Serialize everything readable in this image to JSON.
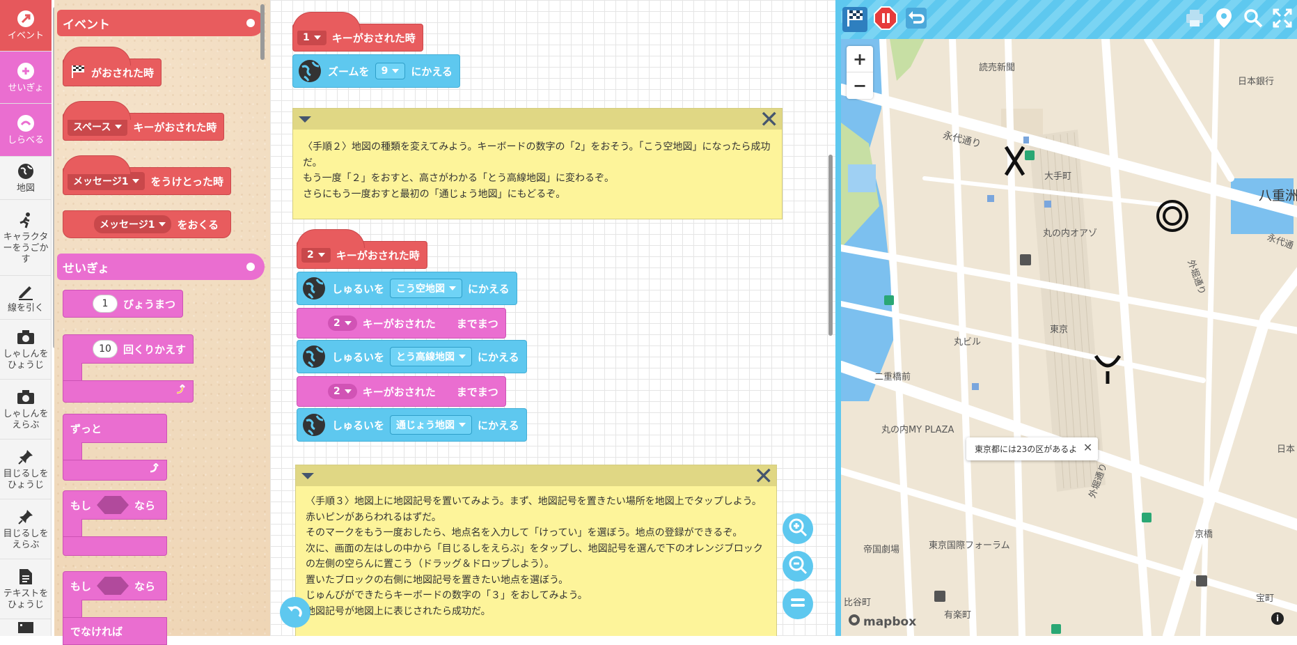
{
  "sidebar": {
    "items": [
      {
        "label": "イベント"
      },
      {
        "label": "せいぎょ"
      },
      {
        "label": "しらべる"
      },
      {
        "label": "地図"
      },
      {
        "label": "キャラクターをうごかす"
      },
      {
        "label": "線を引く"
      },
      {
        "label": "しゃしんをひょうじ"
      },
      {
        "label": "しゃしんをえらぶ"
      },
      {
        "label": "目じるしをひょうじ"
      },
      {
        "label": "目じるしをえらぶ"
      },
      {
        "label": "テキストをひょうじ"
      }
    ]
  },
  "palette": {
    "event_header": "イベント",
    "control_header": "せいぎょ",
    "flag_block": "がおされた時",
    "key_block_dropdown": "スペース",
    "key_block_text": "キーがおされた時",
    "msg_recv_dropdown": "メッセージ1",
    "msg_recv_text": "をうけとった時",
    "msg_send_dropdown": "メッセージ1",
    "msg_send_text": "をおくる",
    "wait_value": "1",
    "wait_text": "びょうまつ",
    "repeat_value": "10",
    "repeat_text": "回くりかえす",
    "forever_text": "ずっと",
    "if_text_1": "もし",
    "if_text_2": "なら",
    "ifelse_text_1": "もし",
    "ifelse_text_2": "なら",
    "else_text": "でなければ"
  },
  "workspace": {
    "script1": {
      "key": "1",
      "hat_text": "キーがおされた時",
      "zoom_text1": "ズームを",
      "zoom_value": "9",
      "zoom_text2": "にかえる"
    },
    "note1": {
      "lines": [
        "〈手順２〉地図の種類を変えてみよう。キーボードの数字の「2」をおそう。「こう空地図」になったら成功だ。",
        "もう一度「２」をおすと、高さがわかる「とう高線地図」に変わるぞ。",
        "さらにもう一度おすと最初の「通じょう地図」にもどるぞ。"
      ]
    },
    "script2": {
      "key": "2",
      "hat_text": "キーがおされた時",
      "set1_text1": "しゅるいを",
      "set1_value": "こう空地図",
      "set1_text2": "にかえる",
      "wait1_key": "2",
      "wait1_text1": "キーがおされた",
      "wait1_text2": "までまつ",
      "set2_text1": "しゅるいを",
      "set2_value": "とう高線地図",
      "set2_text2": "にかえる",
      "wait2_key": "2",
      "wait2_text1": "キーがおされた",
      "wait2_text2": "までまつ",
      "set3_text1": "しゅるいを",
      "set3_value": "通じょう地図",
      "set3_text2": "にかえる"
    },
    "note2": {
      "lines": [
        "〈手順３〉地図上に地図記号を置いてみよう。まず、地図記号を置きたい場所を地図上でタップしよう。赤いピンがあらわれるはずだ。",
        "そのマークをもう一度おしたら、地点名を入力して「けってい」を選ぼう。地点の登録ができるぞ。",
        "次に、画面の左はしの中から「目じるしをえらぶ」をタップし、地図記号を選んで下のオレンジブロックの左側の空らんに置こう（ドラッグ＆ドロップしよう）。",
        "置いたブロックの右側に地図記号を置きたい地点を選ぼう。",
        "じゅんびができたらキーボードの数字の「３」をおしてみよう。",
        "地図記号が地図上に表じされたら成功だ。"
      ]
    }
  },
  "map": {
    "labels": {
      "yomiuri": "読売新聞",
      "nichigin": "日本銀行",
      "eitai": "永代通り",
      "otemachi": "大手町",
      "marunouchi_oazo": "丸の内オアゾ",
      "yaesu": "八重洲",
      "eitai2": "永代通",
      "sotobori": "外堀通り",
      "marubiru": "丸ビル",
      "tokyo": "東京",
      "nijubashi": "二重橋前",
      "myplaza": "丸の内MY PLAZA",
      "sotobori2": "外堀通り",
      "nihon": "日本",
      "teikoku": "帝国劇場",
      "forum": "東京国際フォーラム",
      "kyobashi": "京橋",
      "takara": "宝町",
      "yurakucho": "有楽町",
      "hibiya": "比谷町"
    },
    "popup_text": "東京都には23の区があるよ",
    "attribution": "mapbox",
    "colors": {
      "water": "#7cc0ef",
      "park": "#c7dfa4",
      "land": "#efe6d5",
      "road": "#ffffff"
    }
  }
}
